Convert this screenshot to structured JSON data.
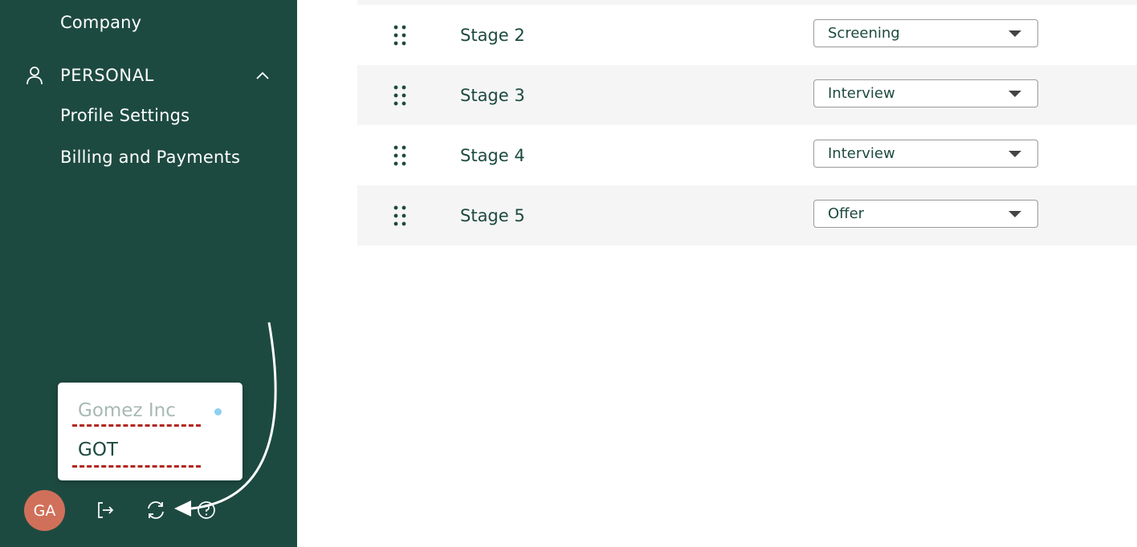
{
  "sidebar": {
    "company_label": "Company",
    "personal": {
      "title": "PERSONAL",
      "icon": "person-icon",
      "expanded_icon": "chevron-up-icon",
      "items": [
        {
          "label": "Profile Settings"
        },
        {
          "label": "Billing and Payments"
        }
      ]
    }
  },
  "account_switcher": {
    "accounts": [
      {
        "name": "Gomez Inc",
        "state": "inactive"
      },
      {
        "name": "GOT",
        "state": "active"
      }
    ],
    "status_dot_color": "#8fd0ef"
  },
  "toolbar": {
    "avatar_initials": "GA",
    "avatar_color": "#d0705a",
    "icons": [
      "logout-icon",
      "refresh-icon",
      "help-icon"
    ]
  },
  "stages": [
    {
      "name": "Stage 2",
      "type": "Screening"
    },
    {
      "name": "Stage 3",
      "type": "Interview"
    },
    {
      "name": "Stage 4",
      "type": "Interview"
    },
    {
      "name": "Stage 5",
      "type": "Offer"
    }
  ],
  "colors": {
    "sidebar_bg": "#1d4a40",
    "annotation_dash": "#b3261e",
    "row_alt_bg": "#f5f5f5"
  }
}
